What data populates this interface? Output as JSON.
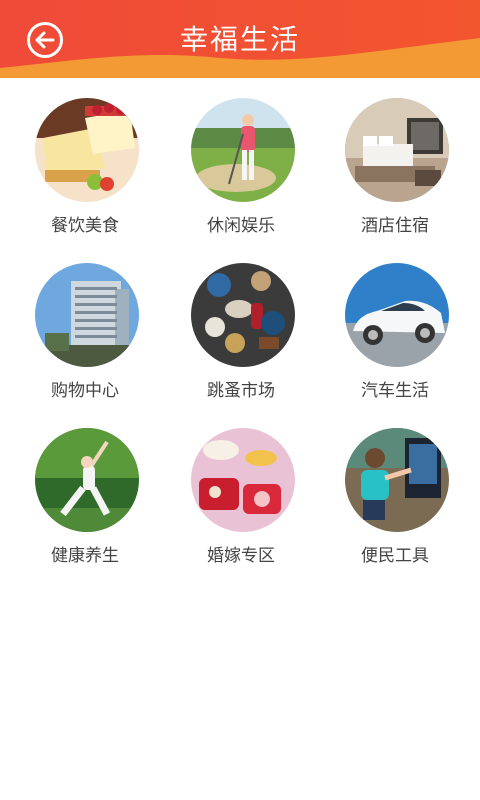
{
  "header": {
    "title": "幸福生活",
    "back_icon": "back-arrow-icon",
    "colors": {
      "start": "#f1533a",
      "end": "#f29231"
    }
  },
  "categories": [
    {
      "label": "餐饮美食",
      "image": "cake-dessert-photo"
    },
    {
      "label": "休闲娱乐",
      "image": "golf-player-photo"
    },
    {
      "label": "酒店住宿",
      "image": "hotel-room-photo"
    },
    {
      "label": "购物中心",
      "image": "office-building-photo"
    },
    {
      "label": "跳蚤市场",
      "image": "antiques-market-photo"
    },
    {
      "label": "汽车生活",
      "image": "white-car-photo"
    },
    {
      "label": "健康养生",
      "image": "yoga-woman-photo"
    },
    {
      "label": "婚嫁专区",
      "image": "wedding-items-photo"
    },
    {
      "label": "便民工具",
      "image": "child-touchscreen-photo"
    }
  ]
}
